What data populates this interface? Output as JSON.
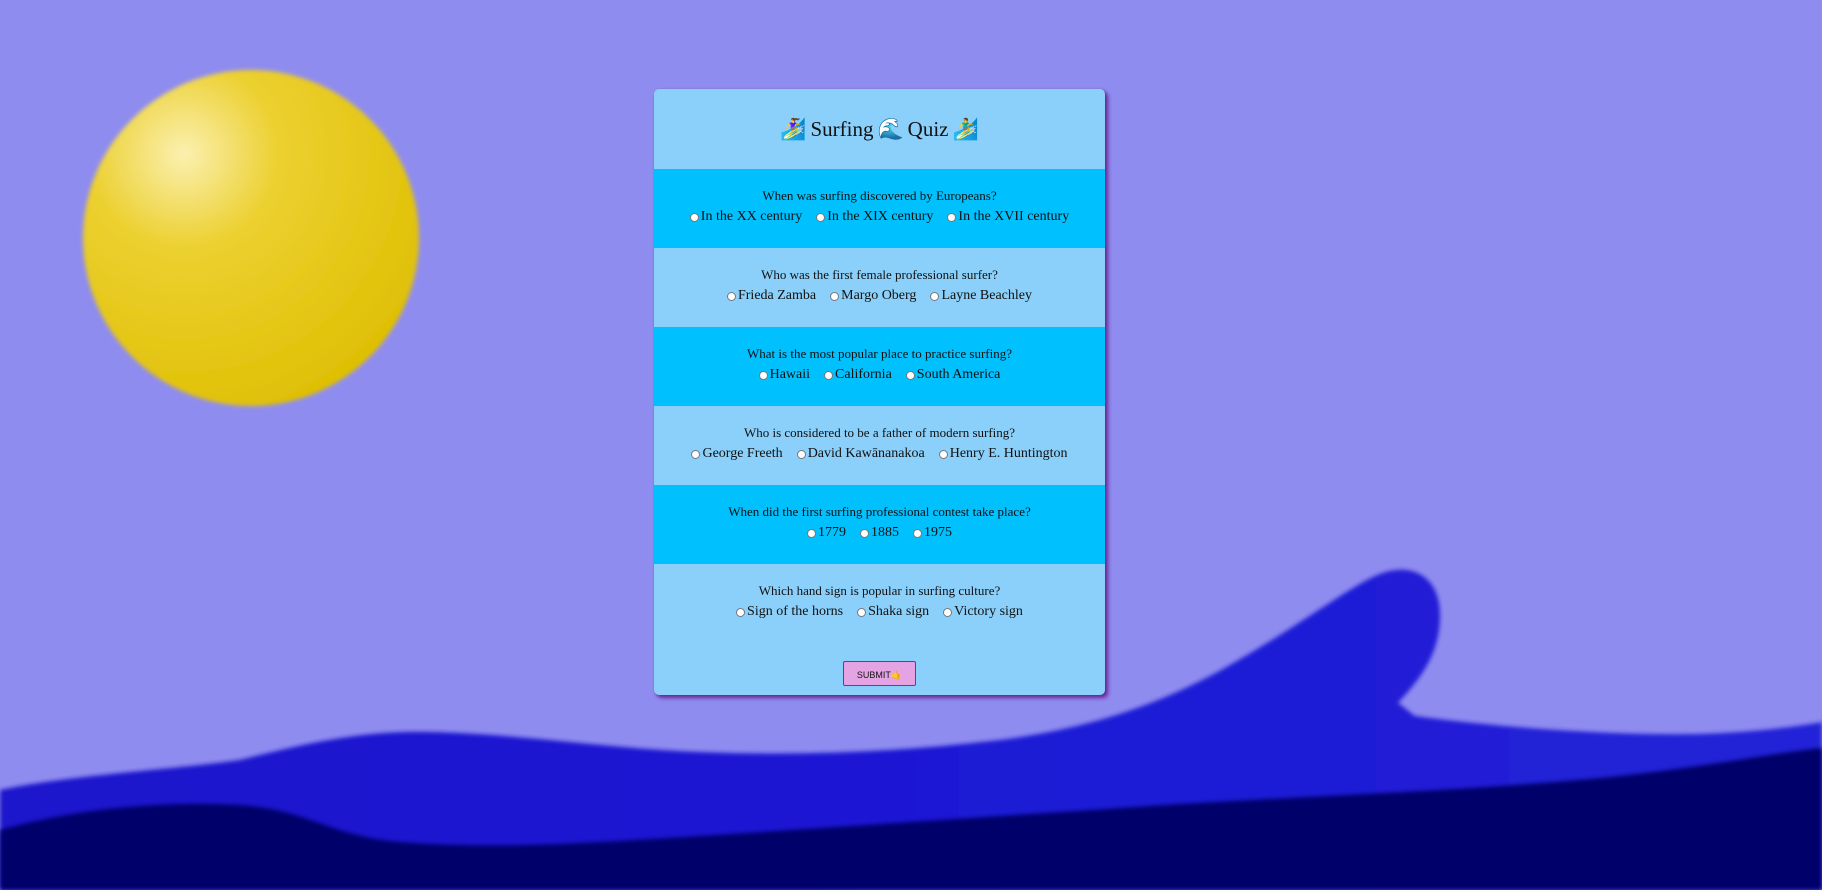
{
  "quiz": {
    "title": {
      "icon_left": "🏄‍♀️",
      "word1": "Surfing",
      "icon_middle": "🌊",
      "word2": "Quiz",
      "icon_right": "🏄‍♂️"
    },
    "questions": [
      {
        "text": "When was surfing discovered by Europeans?",
        "options": [
          "In the XX century",
          "In the XIX century",
          "In the XVII century"
        ]
      },
      {
        "text": "Who was the first female professional surfer?",
        "options": [
          "Frieda Zamba",
          "Margo Oberg",
          "Layne Beachley"
        ]
      },
      {
        "text": "What is the most popular place to practice surfing?",
        "options": [
          "Hawaii",
          "California",
          "South America"
        ]
      },
      {
        "text": "Who is considered to be a father of modern surfing?",
        "options": [
          "George Freeth",
          "David Kawānanakoa",
          "Henry E. Huntington"
        ]
      },
      {
        "text": "When did the first surfing professional contest take place?",
        "options": [
          "1779",
          "1885",
          "1975"
        ]
      },
      {
        "text": "Which hand sign is popular in surfing culture?",
        "options": [
          "Sign of the horns",
          "Shaka sign",
          "Victory sign"
        ]
      }
    ],
    "submit_label": "SUBMIT🤙"
  },
  "colors": {
    "sky": "#8f8cf0",
    "sun": "#e8c80e",
    "card": "#8ad0fa",
    "question_band": "#00c0fe",
    "wave": "#1a14d0",
    "deep_sea": "#05066a",
    "submit_button": "#e4a4e4"
  },
  "icons": [
    "surfer-icon",
    "wave-icon",
    "sun-illustration",
    "wave-illustration"
  ]
}
